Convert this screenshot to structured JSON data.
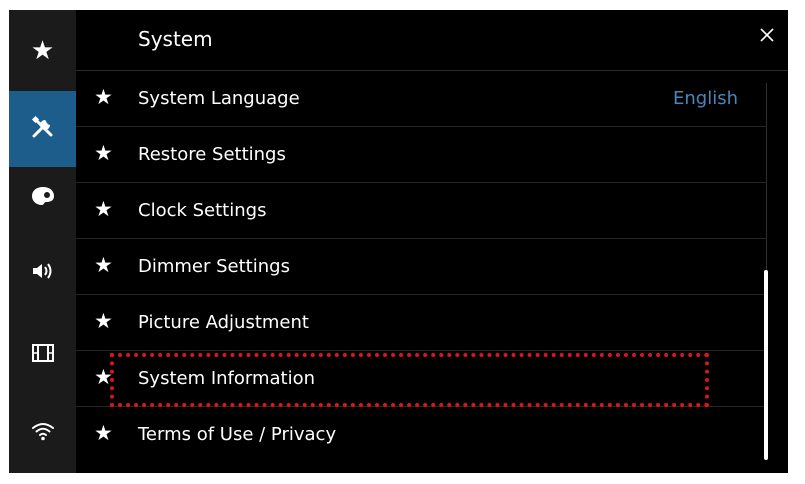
{
  "header": {
    "title": "System"
  },
  "sidebar": {
    "items": [
      {
        "icon": "star-icon",
        "glyph": "★",
        "active": false
      },
      {
        "icon": "tools-icon",
        "glyph": "",
        "active": true
      },
      {
        "icon": "palette-icon",
        "glyph": "",
        "active": false
      },
      {
        "icon": "speaker-icon",
        "glyph": "",
        "active": false
      },
      {
        "icon": "film-icon",
        "glyph": "",
        "active": false
      },
      {
        "icon": "wifi-icon",
        "glyph": "",
        "active": false
      }
    ]
  },
  "list": {
    "items": [
      {
        "label": "System Language",
        "value": "English"
      },
      {
        "label": "Restore Settings"
      },
      {
        "label": "Clock Settings"
      },
      {
        "label": "Dimmer Settings"
      },
      {
        "label": "Picture Adjustment"
      },
      {
        "label": "System Information"
      },
      {
        "label": "Terms of Use / Privacy"
      }
    ]
  },
  "colors": {
    "accent": "#1d5d8c",
    "value_text": "#4a86b8",
    "highlight": "#e01414"
  }
}
